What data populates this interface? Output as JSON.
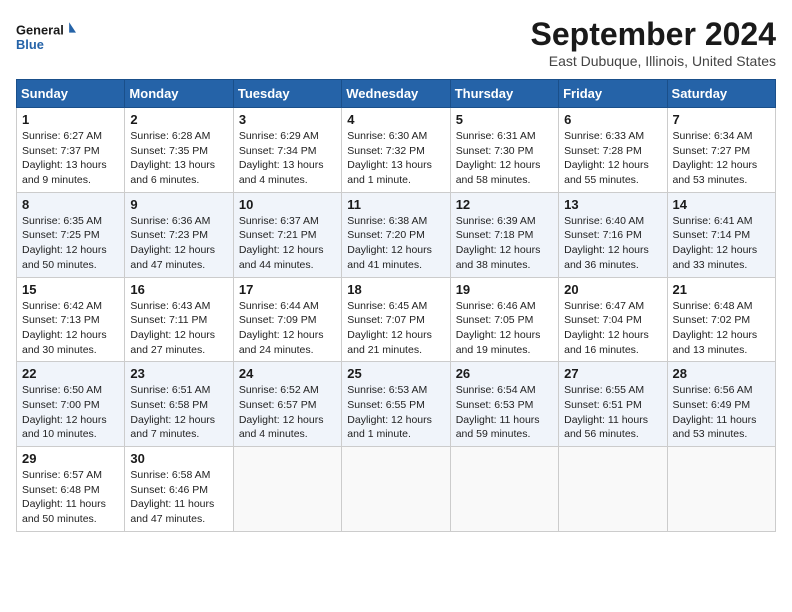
{
  "logo": {
    "line1": "General",
    "line2": "Blue"
  },
  "title": "September 2024",
  "location": "East Dubuque, Illinois, United States",
  "headers": [
    "Sunday",
    "Monday",
    "Tuesday",
    "Wednesday",
    "Thursday",
    "Friday",
    "Saturday"
  ],
  "weeks": [
    [
      {
        "day": "1",
        "lines": [
          "Sunrise: 6:27 AM",
          "Sunset: 7:37 PM",
          "Daylight: 13 hours",
          "and 9 minutes."
        ]
      },
      {
        "day": "2",
        "lines": [
          "Sunrise: 6:28 AM",
          "Sunset: 7:35 PM",
          "Daylight: 13 hours",
          "and 6 minutes."
        ]
      },
      {
        "day": "3",
        "lines": [
          "Sunrise: 6:29 AM",
          "Sunset: 7:34 PM",
          "Daylight: 13 hours",
          "and 4 minutes."
        ]
      },
      {
        "day": "4",
        "lines": [
          "Sunrise: 6:30 AM",
          "Sunset: 7:32 PM",
          "Daylight: 13 hours",
          "and 1 minute."
        ]
      },
      {
        "day": "5",
        "lines": [
          "Sunrise: 6:31 AM",
          "Sunset: 7:30 PM",
          "Daylight: 12 hours",
          "and 58 minutes."
        ]
      },
      {
        "day": "6",
        "lines": [
          "Sunrise: 6:33 AM",
          "Sunset: 7:28 PM",
          "Daylight: 12 hours",
          "and 55 minutes."
        ]
      },
      {
        "day": "7",
        "lines": [
          "Sunrise: 6:34 AM",
          "Sunset: 7:27 PM",
          "Daylight: 12 hours",
          "and 53 minutes."
        ]
      }
    ],
    [
      {
        "day": "8",
        "lines": [
          "Sunrise: 6:35 AM",
          "Sunset: 7:25 PM",
          "Daylight: 12 hours",
          "and 50 minutes."
        ]
      },
      {
        "day": "9",
        "lines": [
          "Sunrise: 6:36 AM",
          "Sunset: 7:23 PM",
          "Daylight: 12 hours",
          "and 47 minutes."
        ]
      },
      {
        "day": "10",
        "lines": [
          "Sunrise: 6:37 AM",
          "Sunset: 7:21 PM",
          "Daylight: 12 hours",
          "and 44 minutes."
        ]
      },
      {
        "day": "11",
        "lines": [
          "Sunrise: 6:38 AM",
          "Sunset: 7:20 PM",
          "Daylight: 12 hours",
          "and 41 minutes."
        ]
      },
      {
        "day": "12",
        "lines": [
          "Sunrise: 6:39 AM",
          "Sunset: 7:18 PM",
          "Daylight: 12 hours",
          "and 38 minutes."
        ]
      },
      {
        "day": "13",
        "lines": [
          "Sunrise: 6:40 AM",
          "Sunset: 7:16 PM",
          "Daylight: 12 hours",
          "and 36 minutes."
        ]
      },
      {
        "day": "14",
        "lines": [
          "Sunrise: 6:41 AM",
          "Sunset: 7:14 PM",
          "Daylight: 12 hours",
          "and 33 minutes."
        ]
      }
    ],
    [
      {
        "day": "15",
        "lines": [
          "Sunrise: 6:42 AM",
          "Sunset: 7:13 PM",
          "Daylight: 12 hours",
          "and 30 minutes."
        ]
      },
      {
        "day": "16",
        "lines": [
          "Sunrise: 6:43 AM",
          "Sunset: 7:11 PM",
          "Daylight: 12 hours",
          "and 27 minutes."
        ]
      },
      {
        "day": "17",
        "lines": [
          "Sunrise: 6:44 AM",
          "Sunset: 7:09 PM",
          "Daylight: 12 hours",
          "and 24 minutes."
        ]
      },
      {
        "day": "18",
        "lines": [
          "Sunrise: 6:45 AM",
          "Sunset: 7:07 PM",
          "Daylight: 12 hours",
          "and 21 minutes."
        ]
      },
      {
        "day": "19",
        "lines": [
          "Sunrise: 6:46 AM",
          "Sunset: 7:05 PM",
          "Daylight: 12 hours",
          "and 19 minutes."
        ]
      },
      {
        "day": "20",
        "lines": [
          "Sunrise: 6:47 AM",
          "Sunset: 7:04 PM",
          "Daylight: 12 hours",
          "and 16 minutes."
        ]
      },
      {
        "day": "21",
        "lines": [
          "Sunrise: 6:48 AM",
          "Sunset: 7:02 PM",
          "Daylight: 12 hours",
          "and 13 minutes."
        ]
      }
    ],
    [
      {
        "day": "22",
        "lines": [
          "Sunrise: 6:50 AM",
          "Sunset: 7:00 PM",
          "Daylight: 12 hours",
          "and 10 minutes."
        ]
      },
      {
        "day": "23",
        "lines": [
          "Sunrise: 6:51 AM",
          "Sunset: 6:58 PM",
          "Daylight: 12 hours",
          "and 7 minutes."
        ]
      },
      {
        "day": "24",
        "lines": [
          "Sunrise: 6:52 AM",
          "Sunset: 6:57 PM",
          "Daylight: 12 hours",
          "and 4 minutes."
        ]
      },
      {
        "day": "25",
        "lines": [
          "Sunrise: 6:53 AM",
          "Sunset: 6:55 PM",
          "Daylight: 12 hours",
          "and 1 minute."
        ]
      },
      {
        "day": "26",
        "lines": [
          "Sunrise: 6:54 AM",
          "Sunset: 6:53 PM",
          "Daylight: 11 hours",
          "and 59 minutes."
        ]
      },
      {
        "day": "27",
        "lines": [
          "Sunrise: 6:55 AM",
          "Sunset: 6:51 PM",
          "Daylight: 11 hours",
          "and 56 minutes."
        ]
      },
      {
        "day": "28",
        "lines": [
          "Sunrise: 6:56 AM",
          "Sunset: 6:49 PM",
          "Daylight: 11 hours",
          "and 53 minutes."
        ]
      }
    ],
    [
      {
        "day": "29",
        "lines": [
          "Sunrise: 6:57 AM",
          "Sunset: 6:48 PM",
          "Daylight: 11 hours",
          "and 50 minutes."
        ]
      },
      {
        "day": "30",
        "lines": [
          "Sunrise: 6:58 AM",
          "Sunset: 6:46 PM",
          "Daylight: 11 hours",
          "and 47 minutes."
        ]
      },
      null,
      null,
      null,
      null,
      null
    ]
  ]
}
